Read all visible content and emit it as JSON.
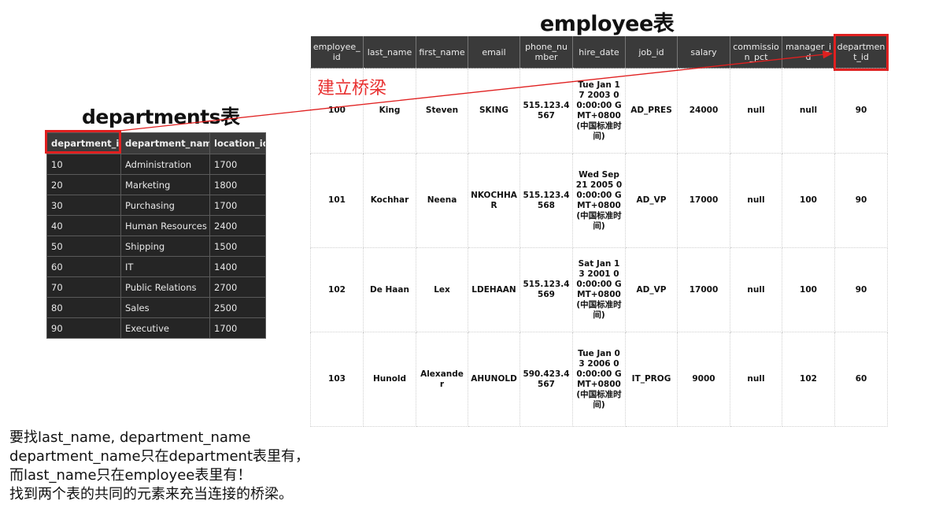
{
  "employee_title": "employee表",
  "departments_title": "departments表",
  "bridge_label": "建立桥梁",
  "departments": {
    "columns": [
      "department_id",
      "department_name",
      "location_id"
    ],
    "rows": [
      [
        "10",
        "Administration",
        "1700"
      ],
      [
        "20",
        "Marketing",
        "1800"
      ],
      [
        "30",
        "Purchasing",
        "1700"
      ],
      [
        "40",
        "Human Resources",
        "2400"
      ],
      [
        "50",
        "Shipping",
        "1500"
      ],
      [
        "60",
        "IT",
        "1400"
      ],
      [
        "70",
        "Public Relations",
        "2700"
      ],
      [
        "80",
        "Sales",
        "2500"
      ],
      [
        "90",
        "Executive",
        "1700"
      ]
    ]
  },
  "employee": {
    "columns": [
      "employee_id",
      "last_name",
      "first_name",
      "email",
      "phone_number",
      "hire_date",
      "job_id",
      "salary",
      "commission_pct",
      "manager_id",
      "department_id"
    ],
    "rows": [
      [
        "100",
        "King",
        "Steven",
        "SKING",
        "515.123.4567",
        "Tue Jan 17 2003 00:00:00 GMT+0800 (中国标准时间)",
        "AD_PRES",
        "24000",
        "null",
        "null",
        "90"
      ],
      [
        "101",
        "Kochhar",
        "Neena",
        "NKOCHHAR",
        "515.123.4568",
        "Wed Sep 21 2005 00:00:00 GMT+0800 (中国标准时间)",
        "AD_VP",
        "17000",
        "null",
        "100",
        "90"
      ],
      [
        "102",
        "De Haan",
        "Lex",
        "LDEHAAN",
        "515.123.4569",
        "Sat Jan 13 2001 00:00:00 GMT+0800 (中国标准时间)",
        "AD_VP",
        "17000",
        "null",
        "100",
        "90"
      ],
      [
        "103",
        "Hunold",
        "Alexander",
        "AHUNOLD",
        "590.423.4567",
        "Tue Jan 03 2006 00:00:00 GMT+0800 (中国标准时间)",
        "IT_PROG",
        "9000",
        "null",
        "102",
        "60"
      ]
    ]
  },
  "explanation": [
    "要找last_name, department_name",
    "department_name只在department表里有，",
    "而last_name只在employee表里有！",
    "找到两个表的共同的元素来充当连接的桥梁。"
  ],
  "colors": {
    "accent": "#e02020",
    "table_dark": "#252525",
    "header_dark": "#3a3a3a"
  }
}
